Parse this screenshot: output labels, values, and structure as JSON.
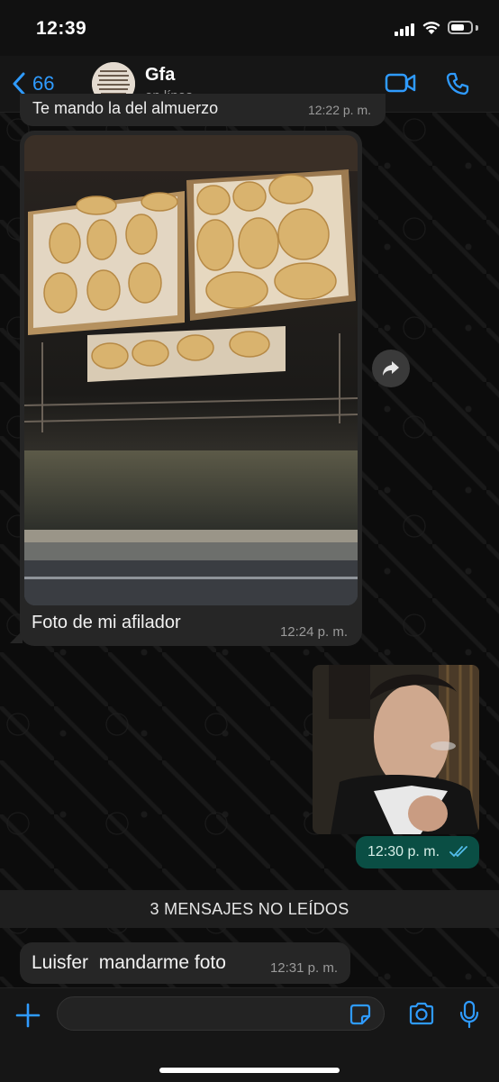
{
  "status_bar": {
    "time": "12:39"
  },
  "header": {
    "back_count": "66",
    "contact_name": "Gfa",
    "contact_status": "en línea",
    "avatar_text": "Creación lle donde tu no puedes llegar y Dios hace lo que tu no puedes hacer"
  },
  "messages": {
    "previous": {
      "text": "Te mando la del almuerzo",
      "time": "12:22 p. m."
    },
    "photo": {
      "caption": "Foto de mi afilador",
      "time": "12:24 p. m."
    },
    "sent": {
      "time": "12:30 p. m."
    },
    "unread_banner": "3 MENSAJES NO LEÍDOS",
    "last": {
      "text": "Luisfer  mandarme foto",
      "time": "12:31 p. m."
    }
  },
  "input": {
    "placeholder": ""
  },
  "colors": {
    "accent": "#2f9bff",
    "sent_bubble": "#0a4e44",
    "received_bubble": "#262626",
    "read_ticks": "#53bdeb"
  },
  "icons": {
    "back": "chevron-left-icon",
    "video": "video-camera-icon",
    "phone": "phone-icon",
    "forward": "forward-arrow-icon",
    "plus": "plus-icon",
    "sticker": "sticker-icon",
    "camera": "camera-icon",
    "mic": "microphone-icon"
  }
}
